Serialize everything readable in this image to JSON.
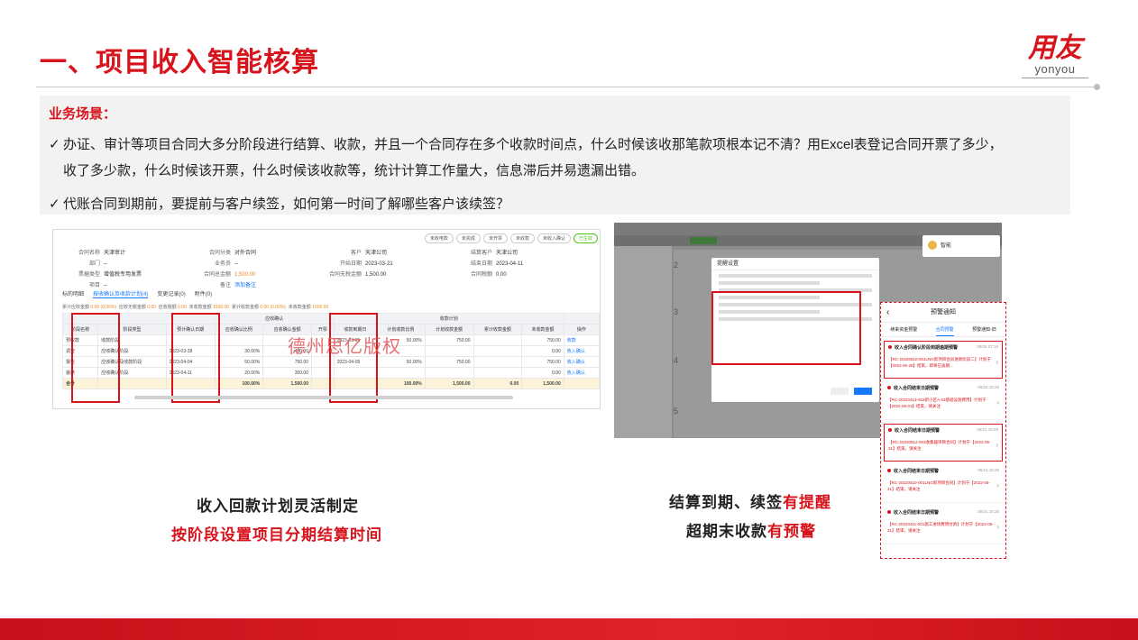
{
  "title": "一、项目收入智能核算",
  "logo": {
    "mark": "用友",
    "sub": "yonyou"
  },
  "scenario": {
    "label": "业务场景：",
    "points": [
      {
        "line1": "办证、审计等项目合同大多分阶段进行结算、收款，并且一个合同存在多个收款时间点，什么时候该收那笔款项根本记不清？用Excel表登记合同开票了多少，",
        "line2": "收了多少款，什么时候该开票，什么时候该收款等，统计计算工作量大，信息滞后并易遗漏出错。"
      },
      {
        "line1": "代账合同到期前，要提前与客户续签，如何第一时间了解哪些客户该续签？"
      }
    ]
  },
  "left_shot": {
    "toolbar": [
      "未收电款",
      "未完成",
      "未开票",
      "未收款",
      "未收入确认",
      "已生效"
    ],
    "form": [
      [
        [
          "合同名称",
          "天津审计"
        ],
        [
          "合同分类",
          "对外合同"
        ],
        [
          "客户",
          "天津公司"
        ],
        [
          "结算客户",
          "天津公司"
        ]
      ],
      [
        [
          "部门",
          "--"
        ],
        [
          "业务员",
          "--"
        ],
        [
          "开始日期",
          "2023-03-21"
        ],
        [
          "结束日期",
          "2023-04-11"
        ]
      ],
      [
        [
          "票据类型",
          "增值税专用发票"
        ],
        [
          "合同总金额",
          "1,500.00"
        ],
        [
          "合同无税金额",
          "1,500.00"
        ],
        [
          "合同税额",
          "0.00"
        ]
      ],
      [
        [
          "项目",
          "--"
        ],
        [
          "备注",
          "添加备注"
        ],
        [
          "",
          ""
        ],
        [
          "",
          ""
        ]
      ]
    ],
    "tabs": [
      "标的明细",
      "按收确认及收款计划(4)",
      "变更记录(0)",
      "附件(0)"
    ],
    "summary": {
      "label1": "累计应收金额",
      "v1": "0.00 (0.00%)",
      "label2": "应收无税金额",
      "v2": "0.00",
      "label3": "应收税额",
      "v3": "0.00",
      "label4": "未收款金额",
      "v4": "1500.00",
      "label5": "累计收款金额",
      "v5": "0.00 (0.00%)",
      "label6": "未收款金额",
      "v6": "1500.00"
    },
    "table": {
      "group1": "应收确认",
      "group2": "收款计划",
      "headers": [
        "阶段名称",
        "阶段类型",
        "预计确认日期",
        "应收确认比例",
        "应收确认金额",
        "开票",
        "收款到期日",
        "计划收款比例",
        "计划收款金额",
        "累计收款金额",
        "未收款金额",
        "操作"
      ],
      "rows": [
        [
          "预收款",
          "收款阶段",
          "",
          "",
          "",
          "",
          "2023-03-21",
          "50.00%",
          "750.00",
          "",
          "750.00",
          "收款"
        ],
        [
          "调查",
          "应收确认阶段",
          "2023-03-28",
          "30.00%",
          "450.00",
          "",
          "",
          "",
          "",
          "",
          "0.00",
          "收入确认"
        ],
        [
          "报告",
          "应收确认及收款阶段",
          "2023-04-04",
          "50.00%",
          "750.00",
          "",
          "2023-04-05",
          "50.00%",
          "750.00",
          "",
          "750.00",
          "收入确认"
        ],
        [
          "装裱",
          "应收确认阶段",
          "2023-04-11",
          "20.00%",
          "300.00",
          "",
          "",
          "",
          "",
          "",
          "0.00",
          "收入确认"
        ]
      ],
      "totals": [
        "合计",
        "",
        "",
        "100.00%",
        "1,500.00",
        "",
        "",
        "100.00%",
        "1,500.00",
        "0.00",
        "1,500.00",
        ""
      ]
    },
    "watermark": "德州思亿版权"
  },
  "right_shot": {
    "steps": [
      "2",
      "3",
      "4",
      "5"
    ],
    "dialog_title": "提醒设置",
    "confirm": "确定",
    "cancel": "取消",
    "popup_name": "智能"
  },
  "phone": {
    "title": "预警通知",
    "tabs": [
      "续来资金预警",
      "合同预警",
      "预警通知-旧"
    ],
    "items": [
      {
        "title": "收入合同确认阶段到期逾期预警",
        "date": "05/25 07:15",
        "body": "【RC-20220510-001LNG新项目合同进款阶段二】计划于【2022-05-26】结束，即将已逾期...",
        "boxed": true
      },
      {
        "title": "收入合同结束日期预警",
        "date": "05/22 15:25",
        "body": "【RC-20220413-003新小区A-03基础设施费用】计划于【2022-06-01】结束，请关注",
        "boxed": false
      },
      {
        "title": "收入合同结束日期预警",
        "date": "05/21 15:25",
        "body": "【RC-20220512-003收集器项目合同】计划于【2022-05-31】结束，请关注",
        "boxed": true
      },
      {
        "title": "收入合同结束日期预警",
        "date": "05/21 15:25",
        "body": "【RC-20220510-001LNG新项目合同】计划于【2022-05-31】结束，请关注",
        "boxed": false
      },
      {
        "title": "收入合同结束日期预警",
        "date": "05/21 15:25",
        "body": "【RC-20220411-001施工进场费用付款】计划于【2022-05-31】结束，请关注",
        "boxed": false
      }
    ]
  },
  "captions": {
    "left1": "收入回款计划灵活制定",
    "left2": "按阶段设置项目分期结算时间",
    "right1_a": "结算到期、续签",
    "right1_b": "有提醒",
    "right2_a": "超期末收款",
    "right2_b": "有预警"
  },
  "colors": {
    "brand_red": "#d7141c",
    "link_blue": "#1677ff"
  }
}
